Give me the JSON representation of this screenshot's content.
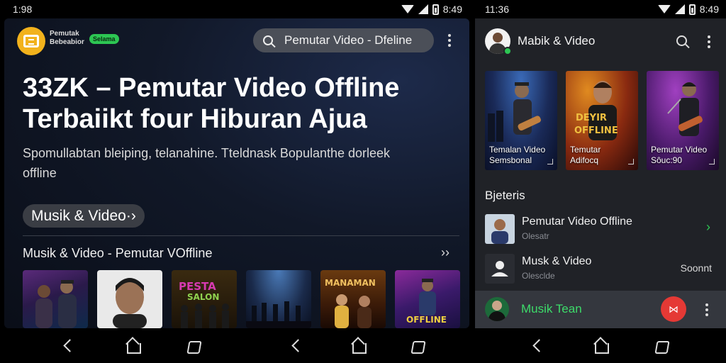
{
  "left_screen": {
    "status": {
      "time": "1:98",
      "clock": "8:49"
    },
    "header": {
      "brand_line1": "Pemutak",
      "brand_line2": "Bebeabior",
      "badge": "Selama",
      "search_text": "Pemutar Video - Dfeline"
    },
    "hero": {
      "headline": "33ZK – Pemutar Video Offline Terbaiikt four Hiburan Ajua",
      "subtitle": "Spomullabtan bleiping, telanahine. Tteldnask Bopulanthe dorleek offline"
    },
    "category_pill": "Musik & Video·›",
    "section": {
      "title": "Musik & Video - Pemutar VOffline",
      "more": "››"
    },
    "thumbnails": [
      {
        "name": "thumb-duo"
      },
      {
        "name": "thumb-portrait"
      },
      {
        "name": "thumb-band-poster",
        "text": "PESTA SALON"
      },
      {
        "name": "thumb-concert-stage"
      },
      {
        "name": "thumb-movie-poster",
        "text": "MANAMAN"
      },
      {
        "name": "thumb-guitarist-poster",
        "text": "OFFLINE"
      }
    ]
  },
  "right_screen": {
    "status": {
      "time": "11:36",
      "clock": "8:49"
    },
    "header": {
      "title": "Mabik & Video"
    },
    "cards": [
      {
        "caption_line1": "Temalan Video",
        "caption_line2": "Semsbonal"
      },
      {
        "caption_line1": "Temutar",
        "caption_line2": "Adifocq",
        "poster_text": "OFFLINE"
      },
      {
        "caption_line1": "Pemutar Video",
        "caption_line2": "Sôuc:90"
      }
    ],
    "category_title": "Bjeteris",
    "rows": [
      {
        "title": "Pemutar Video Offline",
        "subtitle": "Olesatr",
        "trail": "›"
      },
      {
        "title": "Musk & Video",
        "subtitle": "Olesclde",
        "trail": "Soonnt"
      }
    ],
    "now_playing": {
      "title": "Musik Tean",
      "fab": "⋈"
    }
  },
  "colors": {
    "accent_green": "#2dc653",
    "fab_red": "#e53935",
    "logo_yellow": "#f2b21c"
  },
  "icons": [
    "search-icon",
    "more-vert-icon",
    "wifi-icon",
    "signal-icon",
    "battery-icon",
    "back-icon",
    "home-icon",
    "recents-icon",
    "chevron-right-icon"
  ]
}
